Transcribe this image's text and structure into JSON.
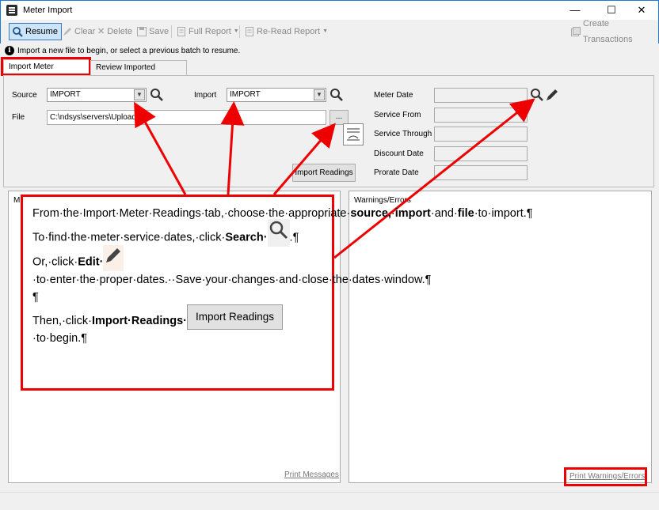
{
  "window": {
    "title": "Meter Import",
    "minimize": "—",
    "maximize": "☐",
    "close": "✕"
  },
  "toolbar": {
    "resume": "Resume",
    "clear": "Clear",
    "delete": "Delete",
    "save": "Save",
    "full_report": "Full Report",
    "reread_report": "Re-Read Report",
    "create_transactions": "Create Transactions"
  },
  "hint": "Import a new file to begin, or select a previous batch to resume.",
  "tabs": {
    "import": "Import Meter Readings",
    "review": "Review Imported Readings"
  },
  "form": {
    "source_label": "Source",
    "source_value": "IMPORT",
    "import_label": "Import",
    "import_value": "IMPORT",
    "file_label": "File",
    "file_value": "C:\\ndsys\\servers\\Upload.dat",
    "browse": "...",
    "import_readings": "Import Readings",
    "meter_date": "Meter Date",
    "service_from": "Service From",
    "service_through": "Service Through",
    "discount_date": "Discount Date",
    "prorate_date": "Prorate Date"
  },
  "panels": {
    "messages_label": "M",
    "warnings_label": "Warnings/Errors",
    "print_messages": "Print Messages",
    "print_warnings": "Print Warnings/Errors"
  },
  "callout": {
    "p1_a": "From·the·Import·Meter·Readings·tab,·choose·the·appropriate·",
    "p1_b": "source,",
    "p1_c": "·",
    "p1_d": "import",
    "p1_e": "·and·",
    "p1_f": "file",
    "p1_g": "·to·import.¶",
    "p2_a": "To·find·the·meter·service·dates,·click·",
    "p2_b": "Search·",
    "p2_c": ".¶",
    "p3_a": "Or,·click·",
    "p3_b": "Edit·",
    "p3_c": "·to·enter·the·proper·dates.··Save·your·changes·and·close·the·dates·window.¶",
    "p4": "¶",
    "p5_a": "Then,·click·",
    "p5_b": "Import·Readings·",
    "p5_btn": "Import Readings",
    "p5_c": "·to·begin.¶"
  },
  "colors": {
    "annotation": "#e00000",
    "titlebar_border": "#1e7bd4"
  }
}
